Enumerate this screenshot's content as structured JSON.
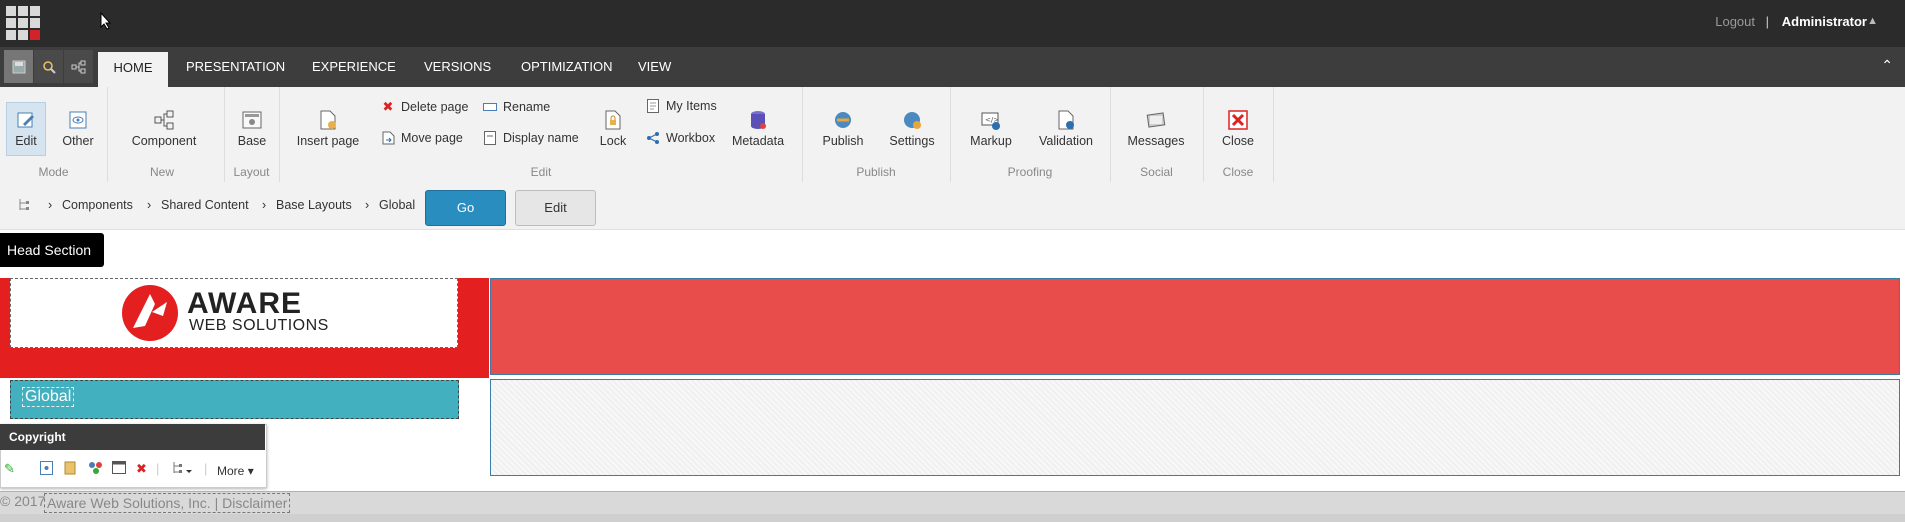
{
  "topbar": {
    "logout": "Logout",
    "separator": "|",
    "user": "Administrator"
  },
  "tabs": [
    "HOME",
    "PRESENTATION",
    "EXPERIENCE",
    "VERSIONS",
    "OPTIMIZATION",
    "VIEW"
  ],
  "ribbon": {
    "mode": {
      "label": "Mode",
      "edit": "Edit",
      "other": "Other"
    },
    "new": {
      "label": "New",
      "component": "Component"
    },
    "layout": {
      "label": "Layout",
      "base": "Base"
    },
    "edit": {
      "label": "Edit",
      "insert_page": "Insert page",
      "delete_page": "Delete page",
      "move_page": "Move page",
      "rename": "Rename",
      "display_name": "Display name",
      "lock": "Lock",
      "my_items": "My Items",
      "workbox": "Workbox",
      "metadata": "Metadata"
    },
    "publish": {
      "label": "Publish",
      "publish": "Publish",
      "settings": "Settings"
    },
    "proofing": {
      "label": "Proofing",
      "markup": "Markup",
      "validation": "Validation"
    },
    "social": {
      "label": "Social",
      "messages": "Messages"
    },
    "close": {
      "label": "Close",
      "close": "Close"
    }
  },
  "breadcrumb": {
    "items": [
      "Components",
      "Shared Content",
      "Base Layouts",
      "Global"
    ],
    "go": "Go",
    "edit": "Edit"
  },
  "content": {
    "head_section": "Head Section",
    "logo": {
      "name": "AWARE",
      "sub": "WEB SOLUTIONS"
    },
    "global_label": "Global",
    "component_toolbar": {
      "title": "Copyright",
      "more": "More"
    },
    "footer": {
      "year": "© 2017",
      "text": "Aware Web Solutions, Inc. | Disclaimer"
    }
  },
  "colors": {
    "accent": "#2a8dbf",
    "brand_red": "#e31f1f",
    "teal": "#43b0c0",
    "topbar": "#2b2b2b"
  }
}
